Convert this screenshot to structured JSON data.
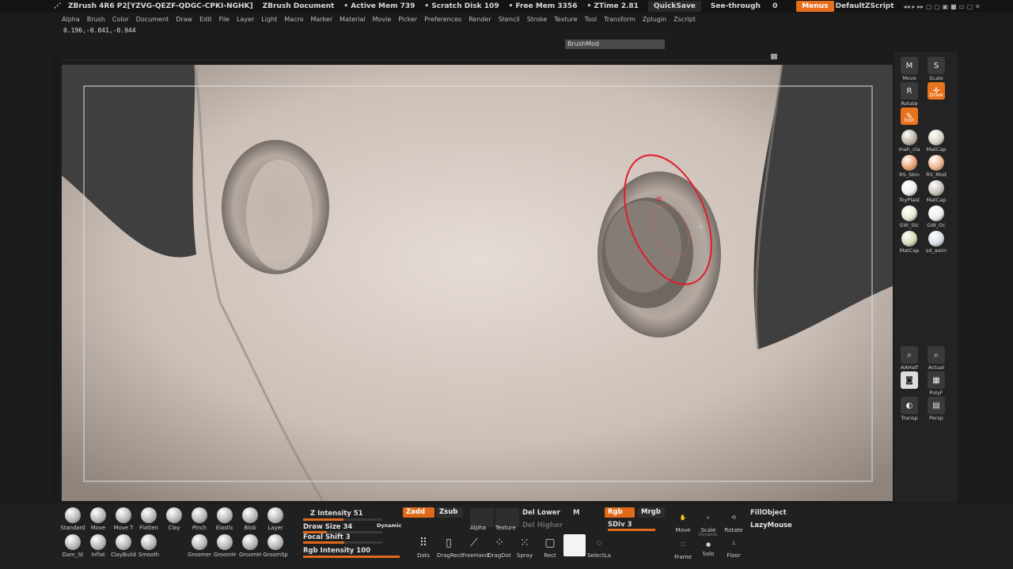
{
  "title": {
    "app": "ZBrush 4R6 P2[YZVG-QEZF-QDGC-CPKI-NGHK]",
    "document": "ZBrush Document",
    "active_mem": "• Active Mem 739",
    "scratch_disk": "• Scratch Disk 109",
    "free_mem": "• Free Mem 3356",
    "ztime": "• ZTime 2.81",
    "quicksave": "QuickSave",
    "see_through": "See-through",
    "see_through_value": "0",
    "menus": "Menus",
    "script": "DefaultZScript"
  },
  "menu": [
    "Alpha",
    "Brush",
    "Color",
    "Document",
    "Draw",
    "Edit",
    "File",
    "Layer",
    "Light",
    "Macro",
    "Marker",
    "Material",
    "Movie",
    "Picker",
    "Preferences",
    "Render",
    "Stencil",
    "Stroke",
    "Texture",
    "Tool",
    "Transform",
    "Zplugin",
    "Zscript"
  ],
  "coords": "0.196,-0.041,-0.944",
  "brushmod": "BrushMod",
  "right_tray": {
    "move": "Move",
    "scale": "Scale",
    "rotate": "Rotate",
    "draw": "Draw",
    "edit": "Edit",
    "materials": [
      {
        "label": "mah_cla",
        "color": "#bdb3a6"
      },
      {
        "label": "MatCap",
        "color": "#d8d4c4"
      },
      {
        "label": "RS_Skin",
        "color": "#f0a070"
      },
      {
        "label": "RS_Mod",
        "color": "#f0b48c"
      },
      {
        "label": "ToyPlast",
        "color": "#f3efec"
      },
      {
        "label": "MatCap",
        "color": "#c8c0b8"
      },
      {
        "label": "GW_Stc",
        "color": "#e6e8cf"
      },
      {
        "label": "GW_Oc",
        "color": "#eeeeee"
      },
      {
        "label": "MatCap",
        "color": "#d9d9b8"
      },
      {
        "label": "sd_asim",
        "color": "#d9dee8"
      }
    ],
    "aahalf": "AAHalf",
    "actual": "Actual",
    "polyf": "PolyF",
    "transp": "Transp",
    "persp": "Persp"
  },
  "brushes_row1": [
    "Standard",
    "Move",
    "Move T",
    "Flatten",
    "Clay",
    "Pinch",
    "Elastic",
    "Blob",
    "Layer"
  ],
  "brushes_row2": [
    "Dam_St",
    "Inflat",
    "ClayBuild",
    "Smooth",
    "Groomer",
    "GroomH",
    "GroomH",
    "GroomSp"
  ],
  "controls": {
    "z_intensity": "Z Intensity 51",
    "z_intensity_value": 51,
    "draw_size": "Draw Size 34",
    "dynamic": "Dynamic",
    "focal_shift": "Focal Shift 3",
    "rgb_intensity": "Rgb Intensity 100",
    "zadd": "Zadd",
    "zsub": "Zsub",
    "alpha": "Alpha",
    "texture": "Texture",
    "del_lower": "Del Lower",
    "del_higher": "Del Higher",
    "m": "M",
    "rgb": "Rgb",
    "mrgb": "Mrgb",
    "sdiv": "SDiv 3"
  },
  "strokes": [
    "Dots",
    "DragRect",
    "FreeHand",
    "DragDot",
    "Spray",
    "Rect"
  ],
  "selectla": "SelectLa",
  "nav": {
    "move": "Move",
    "scale": "Scale",
    "rotate": "Rotate",
    "frame": "Frame",
    "dynamic": "Dynamic",
    "solo": "Solo",
    "floor": "Floor",
    "fillobject": "FillObject",
    "lazymouse": "LazyMouse"
  }
}
